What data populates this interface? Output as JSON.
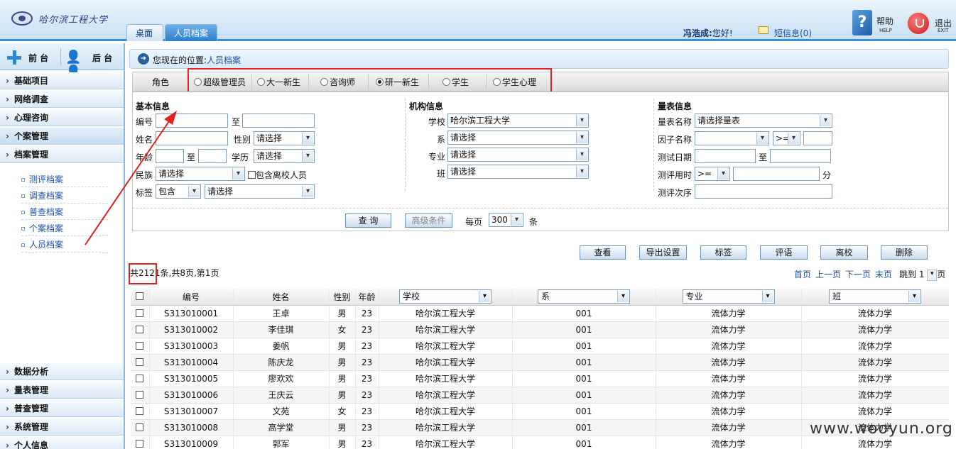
{
  "header": {
    "logo_text": "哈尔滨工程大学",
    "tabs": [
      "桌面",
      "人员档案"
    ],
    "greeting_name": "冯浩成:",
    "greeting_text": "您好!",
    "messages": "短信息(0)",
    "help": "帮助",
    "help_sub": "HELP",
    "exit": "退出",
    "exit_sub": "EXIT"
  },
  "sidebar": {
    "front": "前 台",
    "back": "后 台",
    "menu_top": [
      "基础项目",
      "网络调查",
      "心理咨询",
      "个案管理",
      "档案管理"
    ],
    "archive_items": [
      "测评档案",
      "调查档案",
      "普查档案",
      "个案档案",
      "人员档案"
    ],
    "menu_bottom": [
      "数据分析",
      "量表管理",
      "普查管理",
      "系统管理",
      "个人信息"
    ]
  },
  "location": {
    "prefix": "您现在的位置:",
    "current": "人员档案"
  },
  "roles": {
    "label": "角色",
    "options": [
      "超级管理员",
      "大一新生",
      "咨询师",
      "研一新生",
      "学生",
      "学生心理"
    ],
    "selected_index": 3
  },
  "search": {
    "basic": {
      "title": "基本信息",
      "id_label": "编号",
      "to": "至",
      "name_label": "姓名",
      "gender_label": "性别",
      "gender_value": "请选择",
      "age_label": "年龄",
      "edu_label": "学历",
      "edu_value": "请选择",
      "ethnic_label": "民族",
      "ethnic_value": "请选择",
      "include_left": "包含离校人员",
      "tag_label": "标签",
      "tag_mode": "包含",
      "tag_value": "请选择"
    },
    "org": {
      "title": "机构信息",
      "school_label": "学校",
      "school_value": "哈尔滨工程大学",
      "dept_label": "系",
      "dept_value": "请选择",
      "major_label": "专业",
      "major_value": "请选择",
      "class_label": "班",
      "class_value": "请选择"
    },
    "scale": {
      "title": "量表信息",
      "name_label": "量表名称",
      "name_value": "请选择量表",
      "factor_label": "因子名称",
      "factor_op": ">=",
      "date_label": "测试日期",
      "to": "至",
      "time_label": "测评用时",
      "time_op": ">=",
      "time_unit": "分",
      "order_label": "测评次序"
    },
    "query_btn": "查 询",
    "advanced_btn": "高级条件",
    "per_page_label": "每页",
    "per_page_value": "300",
    "per_page_unit": "条"
  },
  "actions": [
    "查看",
    "导出设置",
    "标签",
    "评语",
    "离校",
    "删除"
  ],
  "summary": {
    "count": "共2121条,共8页,第1页"
  },
  "pager": {
    "first": "首页",
    "prev": "上一页",
    "next": "下一页",
    "last": "末页",
    "jump_label": "跳到",
    "jump_value": "1",
    "page_suffix": "页"
  },
  "table": {
    "headers": [
      "编号",
      "姓名",
      "性别",
      "年龄",
      "学校",
      "系",
      "专业",
      "班"
    ],
    "rows": [
      [
        "S313010001",
        "王卓",
        "男",
        "23",
        "哈尔滨工程大学",
        "001",
        "流体力学",
        "流体力学"
      ],
      [
        "S313010002",
        "李佳琪",
        "女",
        "23",
        "哈尔滨工程大学",
        "001",
        "流体力学",
        "流体力学"
      ],
      [
        "S313010003",
        "姜帆",
        "男",
        "23",
        "哈尔滨工程大学",
        "001",
        "流体力学",
        "流体力学"
      ],
      [
        "S313010004",
        "陈庆龙",
        "男",
        "23",
        "哈尔滨工程大学",
        "001",
        "流体力学",
        "流体力学"
      ],
      [
        "S313010005",
        "廖欢欢",
        "男",
        "23",
        "哈尔滨工程大学",
        "001",
        "流体力学",
        "流体力学"
      ],
      [
        "S313010006",
        "王庆云",
        "男",
        "23",
        "哈尔滨工程大学",
        "001",
        "流体力学",
        "流体力学"
      ],
      [
        "S313010007",
        "文苑",
        "女",
        "23",
        "哈尔滨工程大学",
        "001",
        "流体力学",
        "流体力学"
      ],
      [
        "S313010008",
        "高学堂",
        "男",
        "23",
        "哈尔滨工程大学",
        "001",
        "流体力学",
        "流体力学"
      ],
      [
        "S313010009",
        "郭军",
        "男",
        "23",
        "哈尔滨工程大学",
        "001",
        "流体力学",
        "流体力学"
      ]
    ]
  },
  "watermark": "www.wooyun.org",
  "colors": {
    "highlight": "#e52020",
    "link": "#1f4fa0",
    "accent": "#2d7ecb"
  }
}
